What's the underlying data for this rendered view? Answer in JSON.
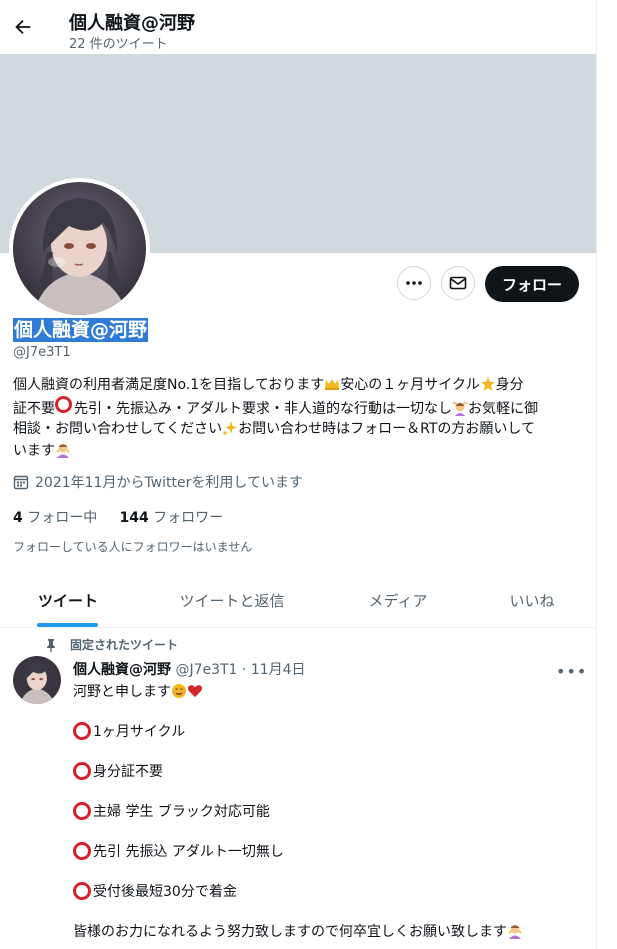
{
  "header": {
    "title": "個人融資@河野",
    "tweet_count": "22 件のツイート"
  },
  "profile": {
    "name": "個人融資@河野",
    "handle": "@J7e3T1",
    "bio_lines": [
      "個人融資の利用者満足度No.1を目指しております",
      "安心の１ヶ月サイクル",
      "身分",
      "証不要",
      "先引・先振込み・アダルト要求・非人道的な行動は一切なし",
      "お気軽に御",
      "相談・お問い合わせしてください",
      "お問い合わせ時はフォロー＆RTの方お願いして",
      "います"
    ],
    "joined": "2021年11月からTwitterを利用しています",
    "following_count": "4",
    "following_label": "フォロー中",
    "followers_count": "144",
    "followers_label": "フォロワー",
    "followed_by_note": "フォローしている人にフォロワーはいません"
  },
  "buttons": {
    "follow": "フォロー"
  },
  "tabs": [
    "ツイート",
    "ツイートと返信",
    "メディア",
    "いいね"
  ],
  "tweet": {
    "pinned_label": "固定されたツイート",
    "author_name": "個人融資@河野",
    "meta": "@J7e3T1 · 11月4日",
    "intro": "河野と申します",
    "items": [
      "1ヶ月サイクル",
      "身分証不要",
      "主婦 学生 ブラック対応可能",
      "先引 先振込 アダルト一切無し",
      "受付後最短30分で着金"
    ],
    "closing": "皆様のお力になれるよう努力致しますので何卒宜しくお願い致します"
  },
  "colors": {
    "accent": "#1d9bf0",
    "banner": "#cfd9de",
    "selection": "#2f7bd6",
    "follow_bg": "#0f1419",
    "red_circle": "#d6232a"
  }
}
